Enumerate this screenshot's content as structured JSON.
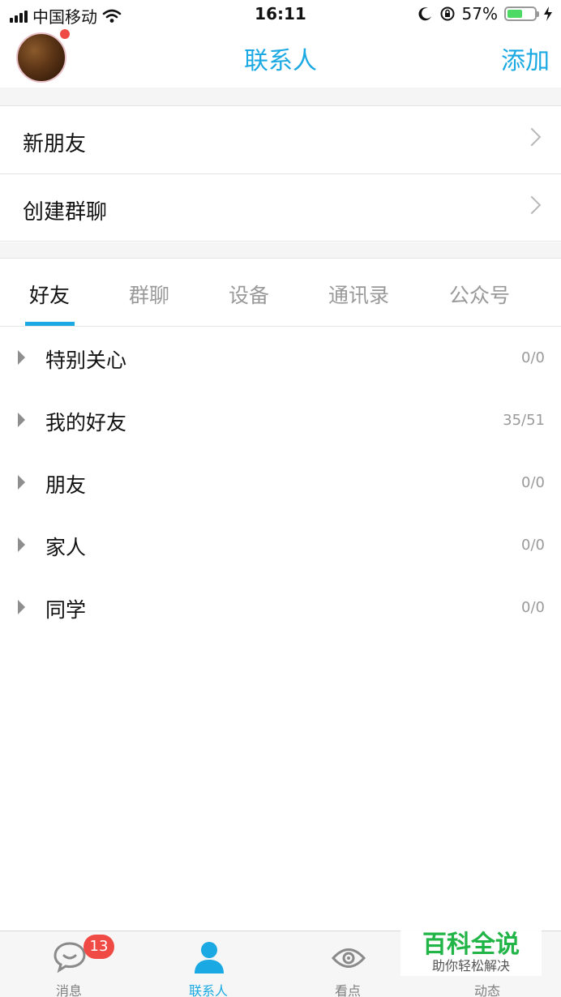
{
  "status_bar": {
    "carrier": "中国移动",
    "time": "16:11",
    "battery_percent": "57%",
    "battery_level": 0.57
  },
  "nav": {
    "title": "联系人",
    "add_label": "添加"
  },
  "shortcuts": [
    {
      "label": "新朋友"
    },
    {
      "label": "创建群聊"
    }
  ],
  "tabs": [
    {
      "label": "好友",
      "active": true
    },
    {
      "label": "群聊"
    },
    {
      "label": "设备"
    },
    {
      "label": "通讯录"
    },
    {
      "label": "公众号"
    }
  ],
  "groups": [
    {
      "label": "特别关心",
      "count": "0/0"
    },
    {
      "label": "我的好友",
      "count": "35/51"
    },
    {
      "label": "朋友",
      "count": "0/0"
    },
    {
      "label": "家人",
      "count": "0/0"
    },
    {
      "label": "同学",
      "count": "0/0"
    }
  ],
  "tab_bar": {
    "items": [
      {
        "label": "消息",
        "icon": "chat-bubble-icon",
        "badge": "13"
      },
      {
        "label": "联系人",
        "icon": "person-icon",
        "active": true
      },
      {
        "label": "看点",
        "icon": "eye-icon"
      },
      {
        "label": "动态",
        "icon": "star-icon"
      }
    ]
  },
  "watermark": {
    "title": "百科全说",
    "subtitle": "助你轻松解决"
  },
  "colors": {
    "accent": "#1aa9e3",
    "badge": "#f04a45",
    "watermark_green": "#21b548"
  }
}
